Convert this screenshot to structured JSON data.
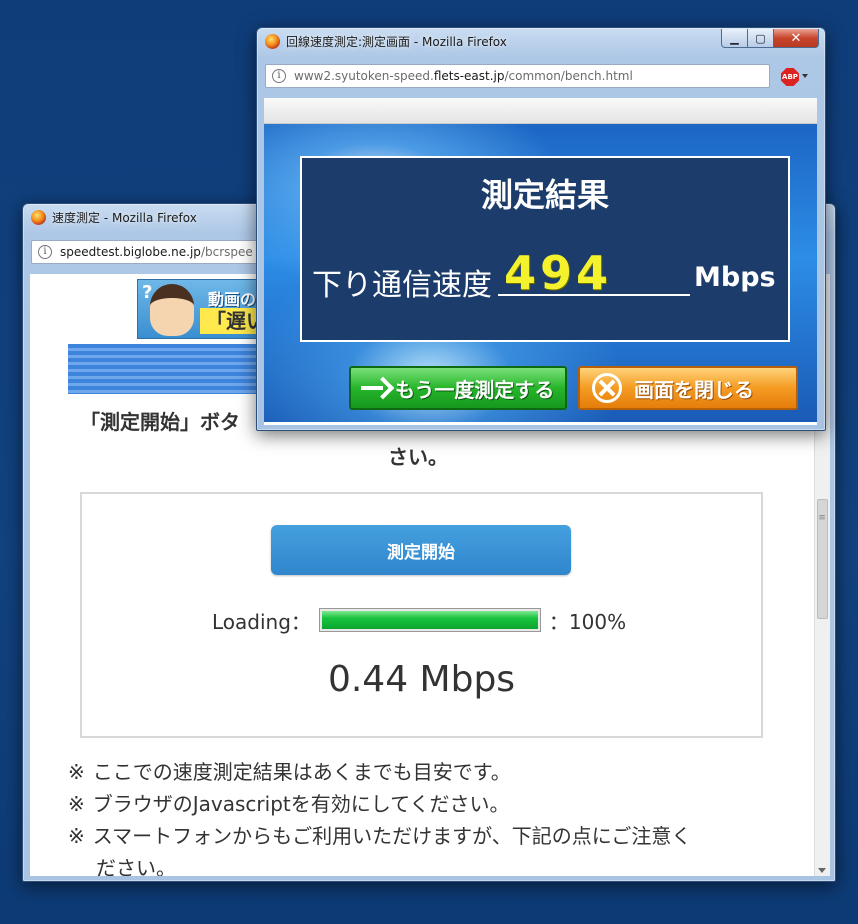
{
  "back_window": {
    "title": "速度測定 - Mozilla Firefox",
    "url_host": "speedtest.biglobe.ne.jp",
    "url_path": "/bcrspee",
    "banner": {
      "question_mark": "?",
      "line1": "動画の",
      "line2": "「遅い"
    },
    "instruction_line1": "「測定開始」ボタ",
    "instruction_line2": "さい。",
    "start_button_label": "測定開始",
    "loading_label": "Loading：",
    "loading_percent_text": "：100%",
    "loading_progress_percent": 100,
    "speed_result": "0.44 Mbps",
    "note_mark": "※",
    "notes": [
      "ここでの速度測定結果はあくまでも目安です。",
      "ブラウザのJavascriptを有効にしてください。",
      "スマートフォンからもご利用いただけますが、下記の点にご注意く",
      "ださい。"
    ]
  },
  "front_window": {
    "title": "回線速度測定:測定画面 - Mozilla Firefox",
    "url_prefix": "www2.syutoken-speed.",
    "url_host": "flets-east.jp",
    "url_path": "/common/bench.html",
    "adblock_label": "ABP",
    "result_title": "測定結果",
    "download_label": "下り通信速度",
    "download_value": "494",
    "download_unit": "Mbps",
    "retest_button_label": "もう一度測定する",
    "close_button_label": "画面を閉じる"
  },
  "icons": {
    "info": "info-icon",
    "firefox": "firefox-icon",
    "minimize": "minimize-icon",
    "maximize": "maximize-icon",
    "close": "close-icon",
    "adblock": "adblock-icon",
    "arrow_right": "arrow-right-icon",
    "x_circle": "x-circle-icon"
  },
  "colors": {
    "desktop": "#12427f",
    "start_button": "#3890d4",
    "progress_green": "#19c23e",
    "result_panel": "#1c3d6b",
    "result_value": "#f4f22c"
  }
}
